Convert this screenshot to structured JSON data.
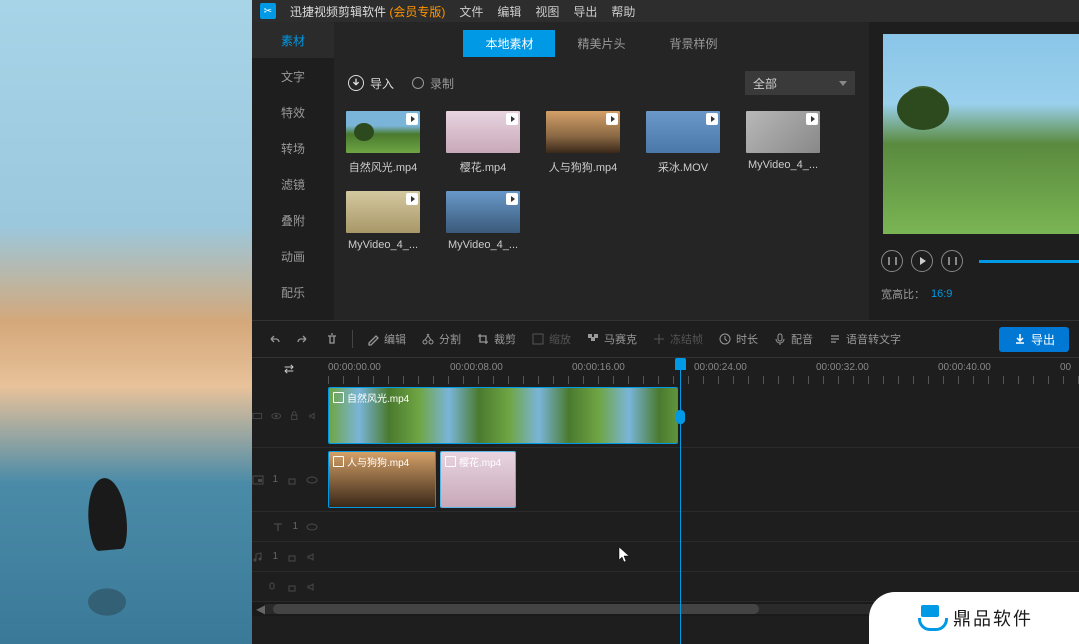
{
  "app": {
    "name": "迅捷视频剪辑软件",
    "edition": "(会员专版)"
  },
  "menu": [
    "文件",
    "编辑",
    "视图",
    "导出",
    "帮助"
  ],
  "sidebar": {
    "items": [
      {
        "label": "素材",
        "active": true
      },
      {
        "label": "文字"
      },
      {
        "label": "特效"
      },
      {
        "label": "转场"
      },
      {
        "label": "滤镜"
      },
      {
        "label": "叠附"
      },
      {
        "label": "动画"
      },
      {
        "label": "配乐"
      }
    ]
  },
  "subtabs": [
    {
      "label": "本地素材",
      "active": true
    },
    {
      "label": "精美片头"
    },
    {
      "label": "背景样例"
    }
  ],
  "import_label": "导入",
  "record_label": "录制",
  "filter_label": "全部",
  "thumbs": [
    {
      "label": "自然风光.mp4",
      "cls": "t-nature"
    },
    {
      "label": "樱花.mp4",
      "cls": "t-sakura"
    },
    {
      "label": "人与狗狗.mp4",
      "cls": "t-person"
    },
    {
      "label": "采冰.MOV",
      "cls": "t-ice"
    },
    {
      "label": "MyVideo_4_...",
      "cls": "t-myv1"
    },
    {
      "label": "MyVideo_4_...",
      "cls": "t-myv2"
    },
    {
      "label": "MyVideo_4_...",
      "cls": "t-myv3"
    }
  ],
  "preview": {
    "aspect_label": "宽高比：",
    "aspect_value": "16:9"
  },
  "toolbar": {
    "edit": "编辑",
    "split": "分割",
    "crop": "裁剪",
    "zoom": "缩放",
    "mosaic": "马赛克",
    "freeze": "冻结帧",
    "duration": "时长",
    "dub": "配音",
    "stt": "语音转文字",
    "export": "导出"
  },
  "ruler": [
    "00:00:00.00",
    "00:00:08.00",
    "00:00:16.00",
    "00:00:24.00",
    "00:00:32.00",
    "00:00:40.00",
    "00"
  ],
  "clips": {
    "main": "自然风光.mp4",
    "pip1": "人与狗狗.mp4",
    "pip2": "樱花.mp4"
  },
  "track_labels": {
    "one": "1"
  },
  "watermark": "鼎品软件"
}
